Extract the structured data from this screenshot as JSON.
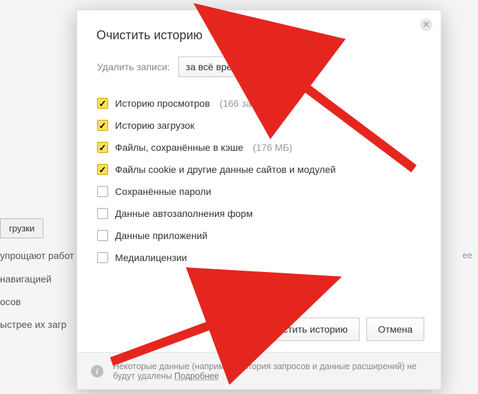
{
  "background": {
    "btn_downloads": "грузки",
    "txt_simplify": "упрощают работ",
    "txt_navigation": "навигацией",
    "txt_requests": "осов",
    "txt_faster": "ыстрее их загр",
    "link_more": "ее"
  },
  "modal": {
    "title": "Очистить историю",
    "period_label": "Удалить записи:",
    "period_value": "за всё время",
    "items": [
      {
        "label": "Историю просмотров",
        "suffix": "(166 записей)",
        "checked": true
      },
      {
        "label": "Историю загрузок",
        "suffix": "",
        "checked": true
      },
      {
        "label": "Файлы, сохранённые в кэше",
        "suffix": "(176 МБ)",
        "checked": true
      },
      {
        "label": "Файлы cookie и другие данные сайтов и модулей",
        "suffix": "",
        "checked": true
      },
      {
        "label": "Сохранённые пароли",
        "suffix": "",
        "checked": false
      },
      {
        "label": "Данные автозаполнения форм",
        "suffix": "",
        "checked": false
      },
      {
        "label": "Данные приложений",
        "suffix": "",
        "checked": false
      },
      {
        "label": "Медиалицензии",
        "suffix": "",
        "checked": false
      }
    ],
    "btn_clear": "Очистить историю",
    "btn_cancel": "Отмена",
    "footer_text": "Некоторые данные (например, история запросов и данные расширений) не будут удалены ",
    "footer_link": "Подробнее"
  }
}
